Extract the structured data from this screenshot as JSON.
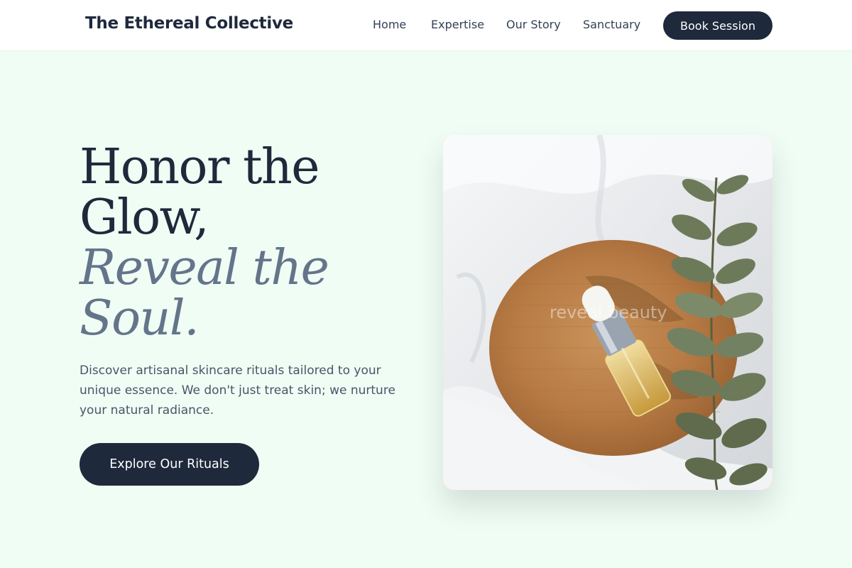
{
  "header": {
    "brand": "The Ethereal Collective",
    "nav": [
      {
        "label": "Home"
      },
      {
        "label": "Expertise"
      },
      {
        "label": "Our Story"
      },
      {
        "label": "Sanctuary"
      }
    ],
    "cta_label": "Book Session"
  },
  "hero": {
    "title_lines": [
      "Honor the",
      "Glow,"
    ],
    "accent_lines": [
      "Reveal the",
      "Soul."
    ],
    "description": "Discover artisanal skincare rituals tailored to your unique essence. We don't just treat skin; we nurture your natural radiance.",
    "cta_label": "Explore Our Rituals",
    "image_watermark": "reveal beauty"
  },
  "colors": {
    "background": "#f0fdf4",
    "primary": "#1e293b",
    "accent_text": "#64748b",
    "body_text": "#475569"
  },
  "icons": {
    "hero_image": "serum-bottle-with-eucalyptus-photo"
  }
}
